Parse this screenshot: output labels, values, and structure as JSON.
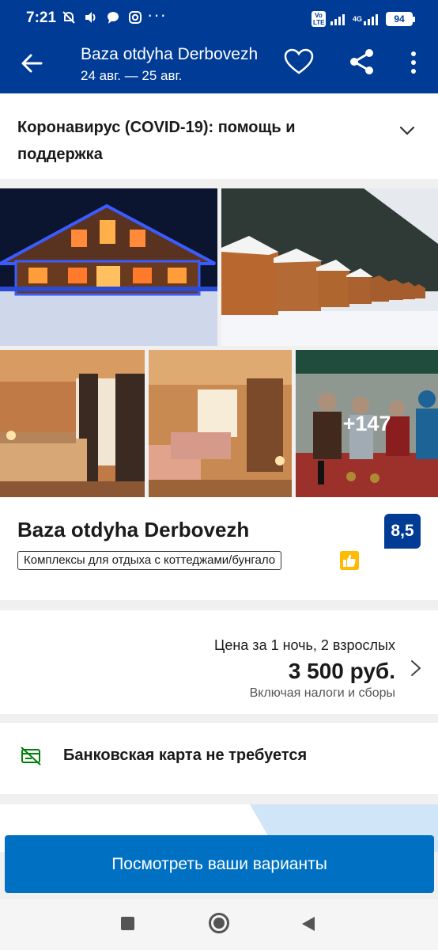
{
  "status_bar": {
    "time": "7:21",
    "network_badge": "Vo LTE",
    "network_type": "4G",
    "battery": "94"
  },
  "app_bar": {
    "title": "Baza otdyha Derbovezh",
    "dates": "24 авг. — 25 авг."
  },
  "covid_banner": {
    "text": "Коронавирус (COVID-19): помощь и поддержка"
  },
  "gallery": {
    "more_photos": "+147"
  },
  "property": {
    "name": "Baza otdyha Derbovezh",
    "score": "8,5",
    "type": "Комплексы для отдыха с коттеджами/бунгало"
  },
  "price": {
    "label": "Цена за 1 ночь, 2 взрослых",
    "value": "3 500 руб.",
    "note": "Включая налоги и сборы"
  },
  "payment": {
    "text": "Банковская карта не требуется"
  },
  "cta": {
    "label": "Посмотреть ваши варианты"
  },
  "colors": {
    "brand_dark": "#003b95",
    "cta": "#0071c2",
    "genius_yellow": "#febb02",
    "payment_icon": "#008009"
  },
  "icons": {
    "back": "back-arrow-icon",
    "favorite": "heart-icon",
    "share": "share-icon",
    "more": "more-vertical-icon",
    "expand": "chevron-down-icon",
    "price_more": "chevron-right-icon",
    "payment": "no-card-icon",
    "quality": "thumbs-up-icon"
  }
}
